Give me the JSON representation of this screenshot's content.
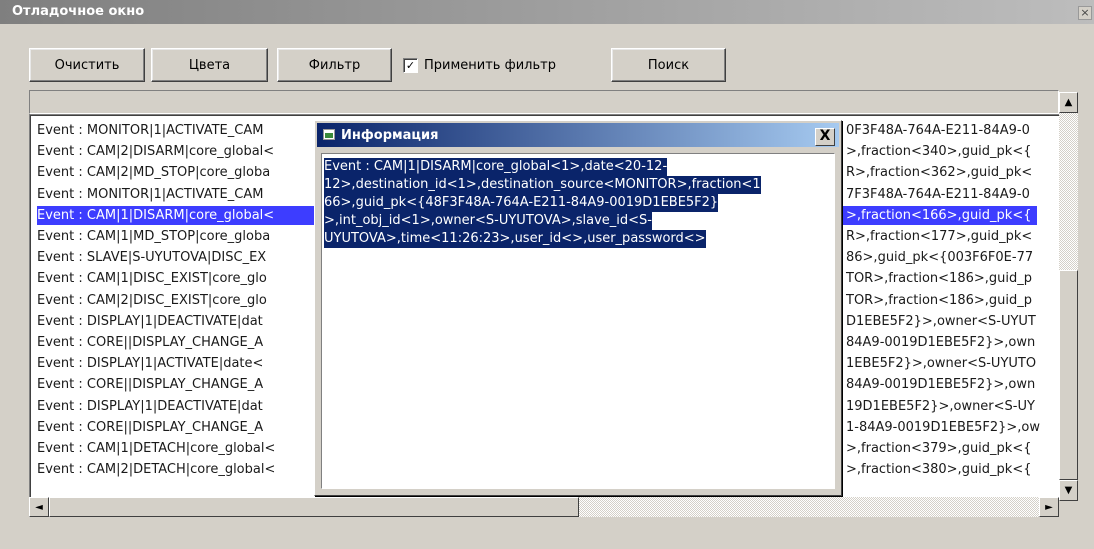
{
  "window": {
    "title": "Отладочное окно",
    "close_glyph": "×"
  },
  "toolbar": {
    "clear_label": "Очистить",
    "colors_label": "Цвета",
    "filter_label": "Фильтр",
    "apply_filter_label": "Применить фильтр",
    "apply_filter_checked": true,
    "search_label": "Поиск"
  },
  "filter_input": {
    "value": ""
  },
  "log_rows": [
    {
      "left": "Event : MONITOR|1|ACTIVATE_CAM",
      "right": "0F3F48A-764A-E211-84A9-0"
    },
    {
      "left": "Event : CAM|2|DISARM|core_global<",
      "right": ">,fraction<340>,guid_pk<{"
    },
    {
      "left": "Event : CAM|2|MD_STOP|core_globa",
      "right": "R>,fraction<362>,guid_pk<"
    },
    {
      "left": "Event : MONITOR|1|ACTIVATE_CAM",
      "right": "7F3F48A-764A-E211-84A9-0"
    },
    {
      "left": "Event : CAM|1|DISARM|core_global<",
      "right": ">,fraction<166>,guid_pk<{"
    },
    {
      "left": "Event : CAM|1|MD_STOP|core_globa",
      "right": "R>,fraction<177>,guid_pk<"
    },
    {
      "left": "Event : SLAVE|S-UYUTOVA|DISC_EX",
      "right": "86>,guid_pk<{003F6F0E-77"
    },
    {
      "left": "Event : CAM|1|DISC_EXIST|core_glo",
      "right": "TOR>,fraction<186>,guid_p"
    },
    {
      "left": "Event : CAM|2|DISC_EXIST|core_glo",
      "right": "TOR>,fraction<186>,guid_p"
    },
    {
      "left": "Event : DISPLAY|1|DEACTIVATE|dat",
      "right": "D1EBE5F2}>,owner<S-UYUT"
    },
    {
      "left": "Event : CORE||DISPLAY_CHANGE_A",
      "right": "84A9-0019D1EBE5F2}>,own"
    },
    {
      "left": "Event : DISPLAY|1|ACTIVATE|date<",
      "right": "1EBE5F2}>,owner<S-UYUTO"
    },
    {
      "left": "Event : CORE||DISPLAY_CHANGE_A",
      "right": "84A9-0019D1EBE5F2}>,own"
    },
    {
      "left": "Event : DISPLAY|1|DEACTIVATE|dat",
      "right": "19D1EBE5F2}>,owner<S-UY"
    },
    {
      "left": "Event : CORE||DISPLAY_CHANGE_A",
      "right": "1-84A9-0019D1EBE5F2}>,ow"
    },
    {
      "left": "Event : CAM|1|DETACH|core_global<",
      "right": ">,fraction<379>,guid_pk<{"
    },
    {
      "left": "Event : CAM|2|DETACH|core_global<",
      "right": ">,fraction<380>,guid_pk<{"
    }
  ],
  "selected_row_index": 4,
  "dialog": {
    "title": "Информация",
    "close_glyph": "X",
    "lines": [
      "Event : CAM|1|DISARM|core_global<1>,date<20-12-",
      "12>,destination_id<1>,destination_source<MONITOR>,fraction<1",
      "66>,guid_pk<{48F3F48A-764A-E211-84A9-0019D1EBE5F2}",
      ">,int_obj_id<1>,owner<S-UYUTOVA>,slave_id<S-",
      "UYUTOVA>,time<11:26:23>,user_id<>,user_password<>"
    ]
  },
  "scroll": {
    "up_glyph": "▲",
    "down_glyph": "▼",
    "left_glyph": "◄",
    "right_glyph": "►"
  },
  "colors": {
    "selection": "#3d3dff",
    "dialog_title": "#0a246a",
    "window_bg": "#d4d0c8"
  }
}
